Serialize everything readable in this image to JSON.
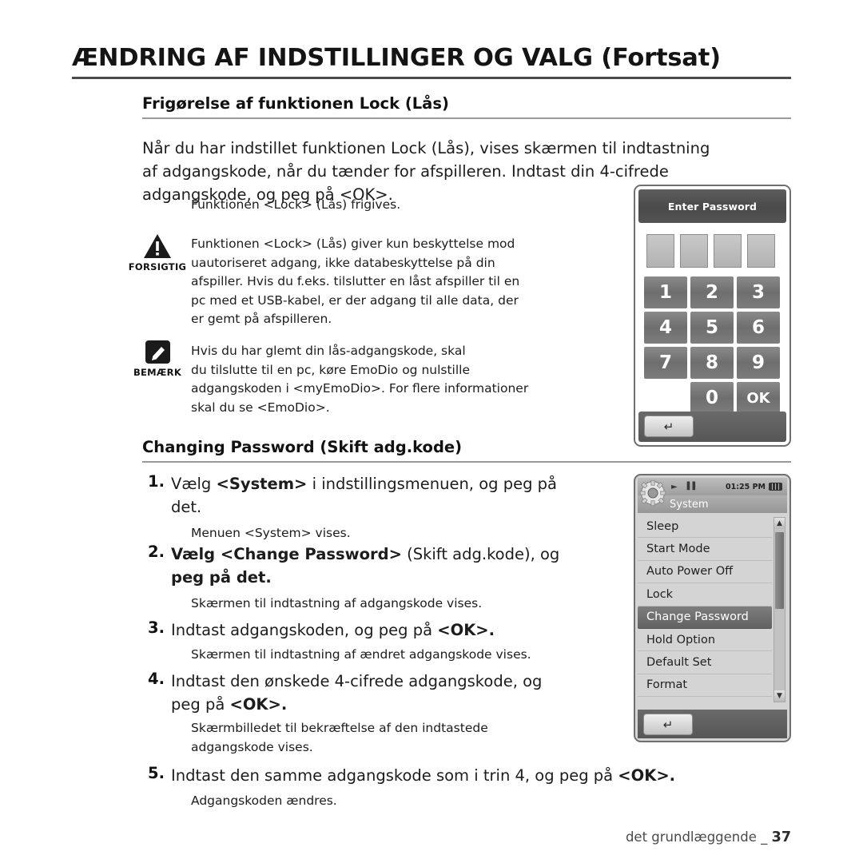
{
  "header": {
    "title": "ÆNDRING AF INDSTILLINGER OG VALG (Fortsat)"
  },
  "sections": {
    "lock": {
      "heading": "Frigørelse af funktionen Lock (Lås)",
      "intro_line1": "Når du har indstillet funktionen Lock (Lås), vises skærmen til indtastning",
      "intro_line2": "af adgangskode, når du tænder for afspilleren. Indtast din 4-cifrede",
      "intro_line3": "adgangskode, og peg på <OK>.",
      "sub_note": "Funktionen <Lock> (Lås) frigives.",
      "caution": {
        "label": "FORSIGTIG",
        "line1": "Funktionen <Lock> (Lås) giver kun beskyttelse mod",
        "line2": "uautoriseret adgang, ikke databeskyttelse på din",
        "line3": "afspiller. Hvis du f.eks. tilslutter en låst afspiller til en",
        "line4": "pc med et USB-kabel, er der adgang til alle data, der",
        "line5": "er gemt på afspilleren."
      },
      "note": {
        "label": "BEMÆRK",
        "line1": "Hvis du har glemt din lås-adgangskode, skal",
        "line2": "du tilslutte til en pc, køre EmoDio og nulstille",
        "line3": "adgangskoden i <myEmoDio>. For flere informationer",
        "line4": "skal du se <EmoDio>."
      }
    },
    "change_password": {
      "heading": "Changing Password (Skift adg.kode)",
      "steps": [
        {
          "num": "1.",
          "line1_a": "Vælg ",
          "line1_b": "<System>",
          "line1_c": " i indstillingsmenuen, og peg på",
          "line2": "det.",
          "note": "Menuen <System> vises."
        },
        {
          "num": "2.",
          "line1_a": "Vælg ",
          "line1_b": "<Change Password>",
          "line1_c": " (Skift adg.kode), og",
          "line2": "peg på det.",
          "note": "Skærmen til indtastning af adgangskode vises."
        },
        {
          "num": "3.",
          "line1_a": "Indtast adgangskoden, og peg på ",
          "line1_b": "<OK>.",
          "line1_c": "",
          "line2": "",
          "note": "Skærmen til indtastning af ændret adgangskode vises."
        },
        {
          "num": "4.",
          "line1_a": "Indtast den ønskede 4-cifrede adgangskode, og",
          "line1_b": "",
          "line1_c": "",
          "line2_a": "peg på ",
          "line2_b": "<OK>.",
          "note_line1": "Skærmbilledet til bekræftelse af den indtastede",
          "note_line2": "adgangskode vises."
        },
        {
          "num": "5.",
          "line1_a": "Indtast den samme adgangskode som i trin 4, og peg på ",
          "line1_b": "<OK>.",
          "note": "Adgangskoden ændres."
        }
      ]
    }
  },
  "password_device": {
    "header_label": "Enter Password",
    "keys": [
      "1",
      "2",
      "3",
      "4",
      "5",
      "6",
      "7",
      "8",
      "9",
      "0",
      "OK"
    ],
    "back_icon": "back-arrow-icon"
  },
  "menu_device": {
    "status": {
      "play_icon": "play-icon",
      "volume_icon": "volume-icon",
      "time": "01:25 PM",
      "battery_icon": "battery-icon"
    },
    "title": "System",
    "items": [
      {
        "label": "Sleep",
        "selected": false
      },
      {
        "label": "Start Mode",
        "selected": false
      },
      {
        "label": "Auto Power Off",
        "selected": false
      },
      {
        "label": "Lock",
        "selected": false
      },
      {
        "label": "Change Password",
        "selected": true
      },
      {
        "label": "Hold Option",
        "selected": false
      },
      {
        "label": "Default Set",
        "selected": false
      },
      {
        "label": "Format",
        "selected": false
      }
    ],
    "scroll_up_icon": "chevron-up-icon",
    "scroll_down_icon": "chevron-down-icon",
    "back_icon": "back-arrow-icon"
  },
  "footer": {
    "text": "det grundlæggende _",
    "page": "37"
  }
}
